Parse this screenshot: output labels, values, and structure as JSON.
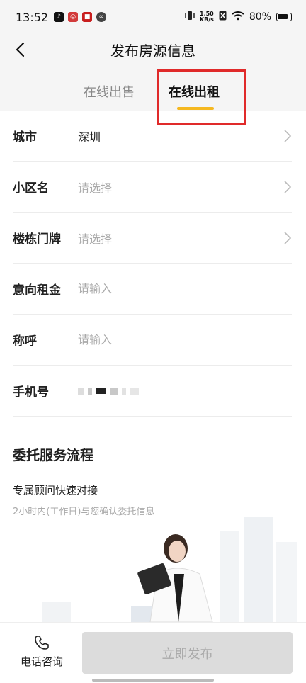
{
  "status_bar": {
    "time": "13:52",
    "net_speed_value": "1.50",
    "net_speed_unit": "KB/s",
    "battery": "80%"
  },
  "header": {
    "title": "发布房源信息"
  },
  "tabs": {
    "items": [
      {
        "label": "在线出售",
        "active": false
      },
      {
        "label": "在线出租",
        "active": true
      }
    ],
    "accent_color": "#f5b820",
    "highlight_color": "#e02a2a"
  },
  "form": {
    "city": {
      "label": "城市",
      "value": "深圳"
    },
    "community": {
      "label": "小区名",
      "placeholder": "请选择"
    },
    "building": {
      "label": "楼栋门牌",
      "placeholder": "请选择"
    },
    "rent": {
      "label": "意向租金",
      "placeholder": "请输入"
    },
    "name": {
      "label": "称呼",
      "placeholder": "请输入"
    },
    "phone": {
      "label": "手机号"
    }
  },
  "process": {
    "title": "委托服务流程",
    "step_title": "专属顾问快速对接",
    "step_desc": "2小时内(工作日)与您确认委托信息"
  },
  "bottom": {
    "phone_label": "电话咨询",
    "publish_label": "立即发布"
  }
}
